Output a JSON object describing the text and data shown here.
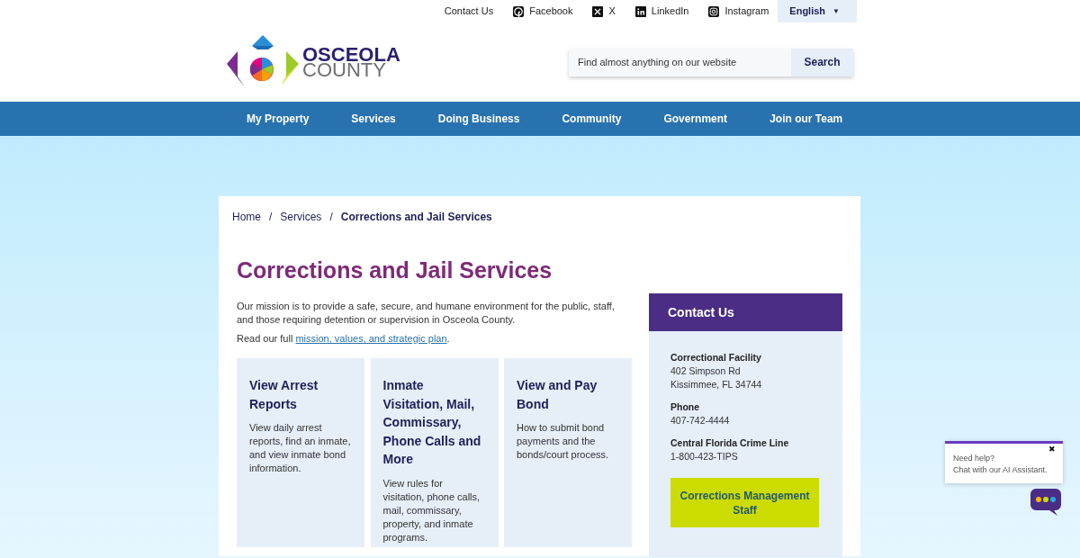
{
  "top_links": [
    {
      "label": "Contact Us",
      "kind": "text"
    },
    {
      "label": "Facebook",
      "kind": "facebook"
    },
    {
      "label": "X",
      "kind": "x"
    },
    {
      "label": "LinkedIn",
      "kind": "linkedin"
    },
    {
      "label": "Instagram",
      "kind": "instagram"
    }
  ],
  "language": {
    "label": "English",
    "caret": "▼"
  },
  "logo": {
    "line_1": "OSCEOLA",
    "line_2": "COUNTY"
  },
  "search": {
    "placeholder": "Find almost anything on our website",
    "button": "Search"
  },
  "nav": [
    "My Property",
    "Services",
    "Doing Business",
    "Community",
    "Government",
    "Join our Team"
  ],
  "breadcrumb": [
    {
      "label": "Home",
      "current": false
    },
    {
      "label": "Services",
      "current": false
    },
    {
      "label": "Corrections and Jail Services",
      "current": true
    }
  ],
  "breadcrumb_separator": "/",
  "title": "Corrections and Jail Services",
  "intro": "Our mission is to provide a safe, secure, and humane environment for the public, staff, and those requiring detention or supervision in Osceola County.",
  "read_more": {
    "before": "Read our full ",
    "link": "mission, values, and strategic plan",
    "after": "."
  },
  "cards": [
    {
      "title": "View Arrest Reports",
      "text": "View daily arrest reports, find an inmate, and view inmate bond information."
    },
    {
      "title": "Inmate Visitation, Mail, Commissary, Phone Calls and More",
      "text": "View rules for visitation, phone calls, mail, commissary, property, and inmate programs."
    },
    {
      "title": "View and Pay Bond",
      "text": "How to submit bond payments and the bonds/court process."
    }
  ],
  "contact": {
    "heading": "Contact Us",
    "groups": [
      {
        "label": "Correctional Facility",
        "lines": [
          "402 Simpson Rd",
          "Kissimmee, FL 34744"
        ]
      },
      {
        "label": "Phone",
        "lines": [
          "407-742-4444"
        ]
      },
      {
        "label": "Central Florida Crime Line",
        "lines": [
          "1-800-423-TIPS"
        ]
      }
    ],
    "button": "Corrections Management Staff"
  },
  "chat_popup": {
    "close": "✖",
    "line_1": "Need help?",
    "line_2": "Chat with our AI Assistant."
  }
}
